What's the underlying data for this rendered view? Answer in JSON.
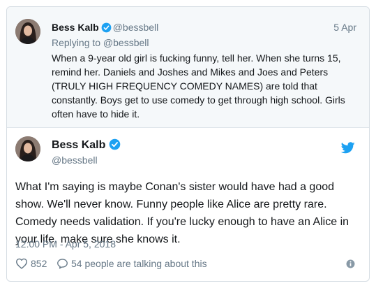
{
  "parent_tweet": {
    "name": "Bess Kalb",
    "handle": "@bessbell",
    "date": "5 Apr",
    "replying_to": "Replying to @bessbell",
    "text": "When a 9-year old girl is fucking funny, tell her. When she turns 15, remind her. Daniels and Joshes and Mikes and Joes and Peters (TRULY HIGH FREQUENCY COMEDY NAMES) are told that constantly. Boys get to use comedy to get through high school. Girls often have to hide it."
  },
  "main_tweet": {
    "name": "Bess Kalb",
    "handle": "@bessbell",
    "text": "What I'm saying is maybe Conan's sister would have had a good show. We'll never know. Funny people like Alice are pretty rare. Comedy needs validation. If you're lucky enough to have an Alice in your life, make sure she knows it.",
    "timestamp": "12:00 PM - Apr 5, 2018",
    "likes": "852",
    "conversation": "54 people are talking about this"
  },
  "icons": {
    "verified": "verified-badge-icon",
    "bird": "twitter-bird-icon",
    "like": "heart-icon",
    "reply": "speech-bubble-icon",
    "info": "info-icon"
  },
  "colors": {
    "brand_blue": "#1da1f2",
    "secondary_text": "#657786",
    "quoted_background": "#f5f8fa"
  }
}
